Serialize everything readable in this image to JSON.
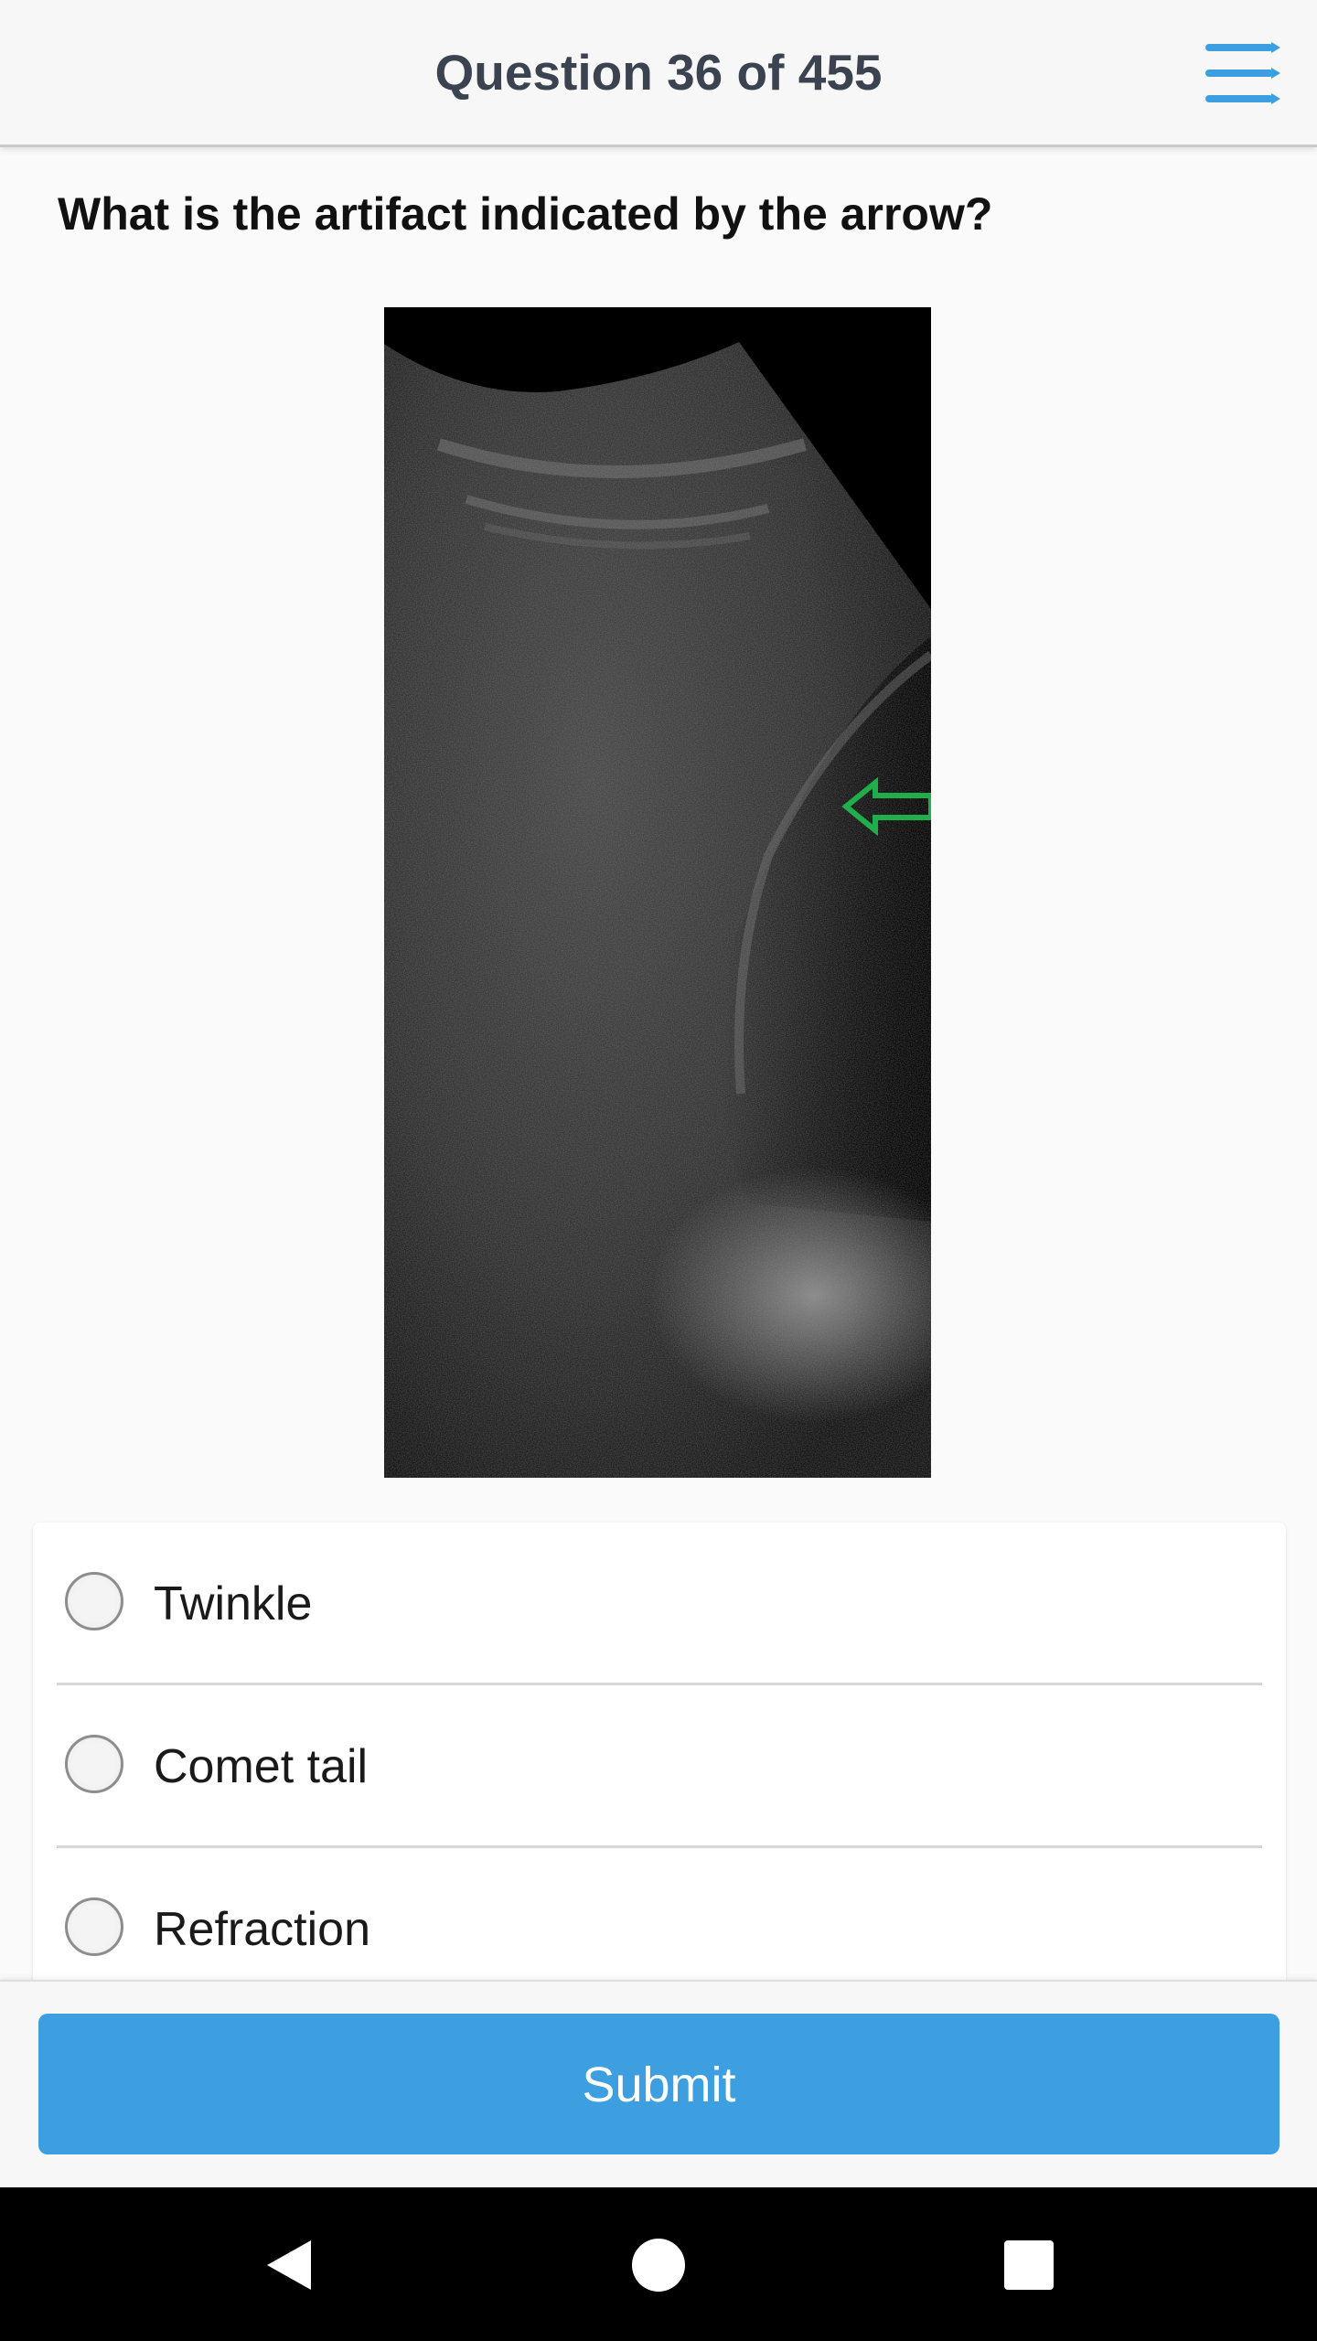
{
  "header": {
    "title": "Question 36 of 455",
    "menu_icon": "hamburger-menu-icon",
    "accent_color": "#3d9fe0"
  },
  "question": {
    "text": "What is the artifact indicated by the arrow?"
  },
  "image": {
    "subject": "ultrasound-image",
    "annotation_icon": "arrow-left-icon",
    "annotation_color": "#1fae4a"
  },
  "options": [
    {
      "label": "Twinkle",
      "selected": false
    },
    {
      "label": "Comet tail",
      "selected": false
    },
    {
      "label": "Refraction",
      "selected": false
    }
  ],
  "actions": {
    "submit_label": "Submit",
    "submit_color": "#3d9fe0"
  },
  "navbar": {
    "icons": [
      "back-icon",
      "home-icon",
      "recents-icon"
    ]
  }
}
